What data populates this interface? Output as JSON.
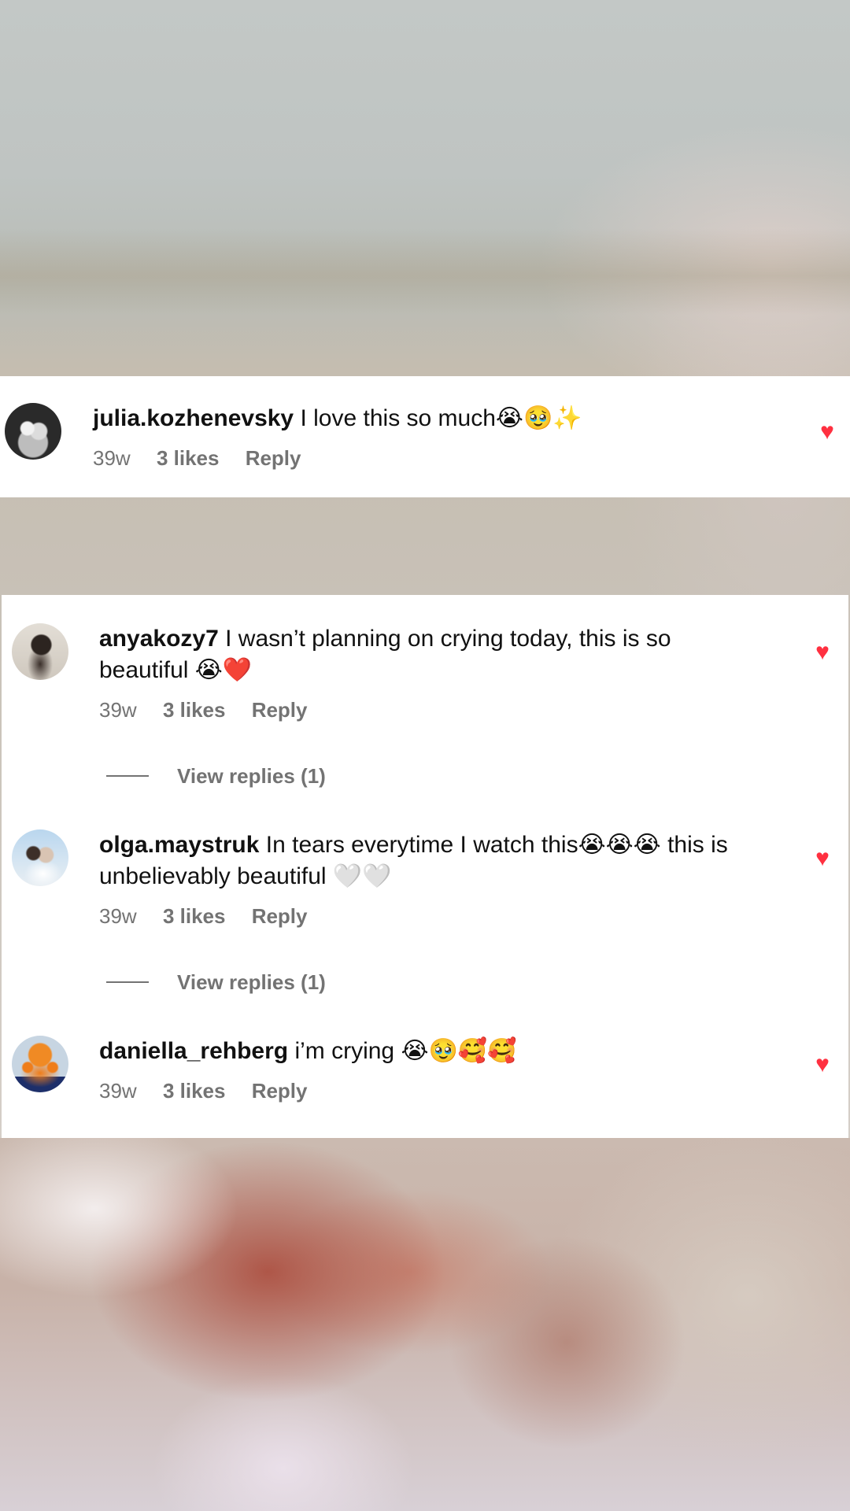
{
  "comments": [
    {
      "username": "julia.kozhenevsky",
      "text": "I love this so much😭🥹✨",
      "time": "39w",
      "likes": "3 likes",
      "reply": "Reply",
      "liked": true
    },
    {
      "username": "anyakozy7",
      "text": "I wasn’t planning on crying today, this is so beautiful 😭❤️",
      "time": "39w",
      "likes": "3 likes",
      "reply": "Reply",
      "liked": true,
      "view_replies": "View replies (1)"
    },
    {
      "username": "olga.maystruk",
      "text": "In tears everytime I watch this😭😭😭 this is unbelievably beautiful 🤍🤍",
      "time": "39w",
      "likes": "3 likes",
      "reply": "Reply",
      "liked": true,
      "view_replies": "View replies (1)"
    },
    {
      "username": "daniella_rehberg",
      "text": "i’m crying 😭🥹🥰🥰",
      "time": "39w",
      "likes": "3 likes",
      "reply": "Reply",
      "liked": true
    }
  ],
  "icons": {
    "heart": "heart-filled-icon"
  },
  "colors": {
    "heart": "#ff3040",
    "meta_text": "#737373",
    "card_bg": "#ffffff"
  }
}
